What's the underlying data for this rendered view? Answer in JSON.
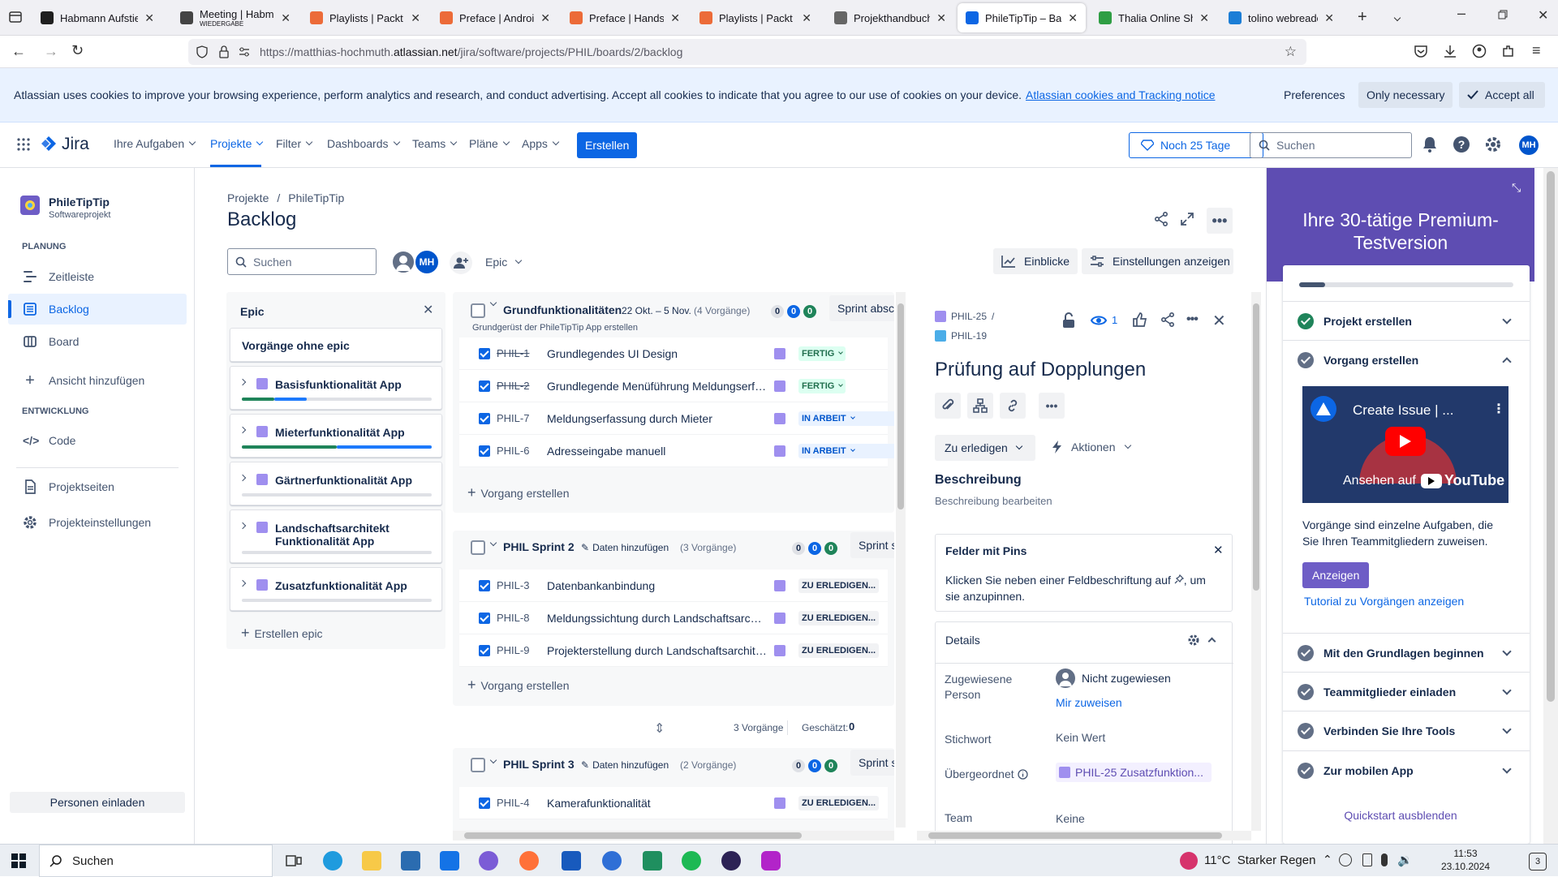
{
  "browser": {
    "tabs": [
      {
        "title": "Habmann Aufstieg",
        "color": "#1f1f1f"
      },
      {
        "title": "Meeting | Habmann",
        "subtitle": "WIEDERGABE",
        "color": "#444444"
      },
      {
        "title": "Playlists | Packt Sub",
        "color": "#ec6b38"
      },
      {
        "title": "Preface | Android D",
        "color": "#ec6b38"
      },
      {
        "title": "Preface | Hands-On",
        "color": "#ec6b38"
      },
      {
        "title": "Playlists | Packt Sub",
        "color": "#ec6b38"
      },
      {
        "title": "Projekthandbuch Ai",
        "color": "#666666"
      },
      {
        "title": "PhileTipTip – Backlo",
        "color": "#0c66e4"
      },
      {
        "title": "Thalia Online Shop |",
        "color": "#2f9e44"
      },
      {
        "title": "tolino webreader",
        "color": "#1c7ed6"
      }
    ],
    "url_prefix": "https://matthias-hochmuth.",
    "url_host": "atlassian.net",
    "url_path": "/jira/software/projects/PHIL/boards/2/backlog"
  },
  "cookie": {
    "text": "Atlassian uses cookies to improve your browsing experience, perform analytics and research, and conduct advertising. Accept all cookies to indicate that you agree to our use of cookies on your device.",
    "link": "Atlassian cookies and Tracking notice",
    "preferences": "Preferences",
    "only_necessary": "Only necessary",
    "accept_all": "Accept all"
  },
  "header": {
    "logo": "Jira",
    "menu": [
      "Ihre Aufgaben",
      "Projekte",
      "Filter",
      "Dashboards",
      "Teams",
      "Pläne",
      "Apps"
    ],
    "create": "Erstellen",
    "trial": "Noch 25 Tage",
    "search_placeholder": "Suchen",
    "avatar": "MH"
  },
  "sidebar": {
    "project_name": "PhileTipTip",
    "project_type": "Softwareprojekt",
    "section_planning": "PLANUNG",
    "timeline": "Zeitleiste",
    "backlog": "Backlog",
    "board": "Board",
    "add_view": "Ansicht hinzufügen",
    "section_dev": "ENTWICKLUNG",
    "code": "Code",
    "pages": "Projektseiten",
    "settings": "Projekteinstellungen",
    "invite": "Personen einladen"
  },
  "page": {
    "breadcrumb_root": "Projekte",
    "breadcrumb_project": "PhileTipTip",
    "title": "Backlog",
    "search_placeholder": "Suchen",
    "avatar": "MH",
    "epic_filter": "Epic",
    "insights": "Einblicke",
    "settings": "Einstellungen anzeigen"
  },
  "epics": {
    "title": "Epic",
    "no_epic": "Vorgänge ohne epic",
    "items": [
      {
        "name": "Basisfunktionalität App",
        "done": 0.17,
        "progress": 0.17
      },
      {
        "name": "Mieterfunktionalität App",
        "done": 0.5,
        "progress": 0.5
      },
      {
        "name": "Gärtnerfunktionalität App",
        "done": 0,
        "progress": 0
      },
      {
        "name": "Landschaftsarchitekt Funktionalität App",
        "done": 0,
        "progress": 0
      },
      {
        "name": "Zusatzfunktionalität App",
        "done": 0,
        "progress": 0
      }
    ],
    "create": "Erstellen epic"
  },
  "sprints": [
    {
      "name": "Grundfunktionalitäten",
      "dates": "22 Okt. – 5 Nov.",
      "count": "(4 Vorgänge)",
      "goal": "Grundgerüst der PhileTipTip App erstellen",
      "counts": [
        "0",
        "0",
        "0"
      ],
      "button": "Sprint abschließen",
      "issues": [
        {
          "key": "PHIL-1",
          "title": "Grundlegendes UI Design",
          "status": "FERTIG",
          "type": "done"
        },
        {
          "key": "PHIL-2",
          "title": "Grundlegende Menüführung Meldungserfassung",
          "status": "FERTIG",
          "type": "done"
        },
        {
          "key": "PHIL-7",
          "title": "Meldungserfassung durch Mieter",
          "status": "IN ARBEIT",
          "type": "prog"
        },
        {
          "key": "PHIL-6",
          "title": "Adresseingabe manuell",
          "status": "IN ARBEIT",
          "type": "prog"
        }
      ],
      "create": "Vorgang erstellen"
    },
    {
      "name": "PHIL Sprint 2",
      "add_dates": "Daten hinzufügen",
      "count": "(3 Vorgänge)",
      "counts": [
        "0",
        "0",
        "0"
      ],
      "button": "Sprint starten",
      "issues": [
        {
          "key": "PHIL-3",
          "title": "Datenbankanbindung",
          "status": "ZU ERLEDIGEN...",
          "type": "todo"
        },
        {
          "key": "PHIL-8",
          "title": "Meldungssichtung durch Landschaftsarchitekten",
          "status": "ZU ERLEDIGEN...",
          "type": "todo"
        },
        {
          "key": "PHIL-9",
          "title": "Projekterstellung durch Landschaftsarchitekten",
          "status": "ZU ERLEDIGEN...",
          "type": "todo"
        }
      ],
      "create": "Vorgang erstellen",
      "footer_count": "3 Vorgänge",
      "estimate_label": "Geschätzt:",
      "estimate": "0"
    },
    {
      "name": "PHIL Sprint 3",
      "add_dates": "Daten hinzufügen",
      "count": "(2 Vorgänge)",
      "counts": [
        "0",
        "0",
        "0"
      ],
      "button": "Sprint starten",
      "issues": [
        {
          "key": "PHIL-4",
          "title": "Kamerafunktionalität",
          "status": "ZU ERLEDIGEN...",
          "type": "todo"
        }
      ]
    }
  ],
  "detail": {
    "parent_key": "PHIL-25",
    "key": "PHIL-19",
    "watchers": "1",
    "title": "Prüfung auf Dopplungen",
    "status": "Zu erledigen",
    "actions": "Aktionen",
    "description_title": "Beschreibung",
    "description_edit": "Beschreibung bearbeiten",
    "pins_title": "Felder mit Pins",
    "pins_text_1": "Klicken Sie neben einer Feldbeschriftung auf",
    "pins_text_2": ", um",
    "pins_text_3": "sie anzupinnen.",
    "details_title": "Details",
    "assignee_label_1": "Zugewiesene",
    "assignee_label_2": "Person",
    "assignee": "Nicht zugewiesen",
    "assign_me": "Mir zuweisen",
    "label_label": "Stichwort",
    "label_value": "Kein Wert",
    "parent_label": "Übergeordnet",
    "parent_value": "PHIL-25 Zusatzfunktion...",
    "team_label": "Team",
    "team_value": "Keine"
  },
  "trial_panel": {
    "title": "Ihre 30-tätige Premium-Testversion",
    "progress": 0.12,
    "items": [
      {
        "label": "Projekt erstellen"
      },
      {
        "label": "Vorgang erstellen"
      },
      {
        "label": "Mit den Grundlagen beginnen"
      },
      {
        "label": "Teammitglieder einladen"
      },
      {
        "label": "Verbinden Sie Ihre Tools"
      },
      {
        "label": "Zur mobilen App"
      }
    ],
    "video_title": "Create Issue | ...",
    "video_watch": "Ansehen auf",
    "video_brand": "YouTube",
    "text": "Vorgänge sind einzelne Aufgaben, die Sie Ihren Teammitgliedern zuweisen.",
    "show": "Anzeigen",
    "tutorial": "Tutorial zu Vorgängen anzeigen",
    "hide": "Quickstart ausblenden",
    "colors": {
      "header": "#5e4db2"
    }
  },
  "taskbar": {
    "search": "Suchen",
    "weather": "11°C  Starker Regen",
    "time": "11:53",
    "date": "23.10.2024",
    "notifications": "3"
  }
}
